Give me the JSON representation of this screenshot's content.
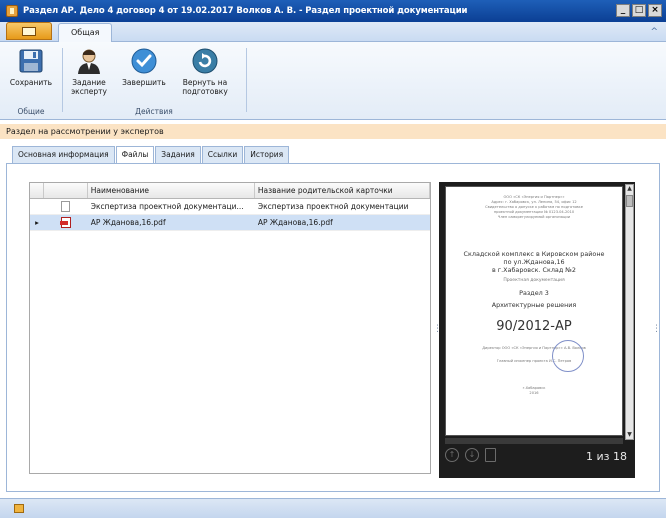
{
  "window": {
    "title": "Раздел АР.  Дело 4 договор 4 от 19.02.2017 Волков А. В. - Раздел проектной документации",
    "controls": [
      "_",
      "□",
      "×"
    ]
  },
  "ribbon": {
    "tab_general": "Общая",
    "collapse_icon": "^",
    "groups": {
      "general": {
        "label": "Общие",
        "save": "Сохранить"
      },
      "actions": {
        "label": "Действия",
        "task_line1": "Задание",
        "task_line2": "эксперту",
        "finish": "Завершить",
        "return_line1": "Вернуть на",
        "return_line2": "подготовку"
      }
    }
  },
  "status_text": "Раздел на рассмотрении у экспертов",
  "tabs": [
    "Основная информация",
    "Файлы",
    "Задания",
    "Ссылки",
    "История"
  ],
  "active_tab": "Файлы",
  "files_table": {
    "columns": [
      "Наименование",
      "Название родительской карточки"
    ],
    "rows": [
      {
        "indicator": "",
        "name": "Экспертиза проектной документаци...",
        "parent": "Экспертиза проектной документации",
        "icon": "document-icon"
      },
      {
        "indicator": "▸",
        "name": "АР Жданова,16.pdf",
        "parent": "АР Жданова,16.pdf",
        "icon": "pdf-icon"
      }
    ]
  },
  "viewer": {
    "pager": "1 из 18",
    "page": {
      "header_lines": [
        "ООО «СК «Энергия и Партнер»»",
        "Адрес: г. Хабаровск, ул. Ленина, 54, офис 12",
        "Свидетельство о допуске к работам по подготовке",
        "проектной документации № 0123.04-2010",
        "Член саморегулируемой организации"
      ],
      "project_lines": [
        "Складской комплекс в Кировском районе",
        "по ул.Жданова,16",
        "в г.Хабаровск. Склад №2"
      ],
      "doc_type": "Проектная документация",
      "section": "Раздел 3",
      "section_title": "Архитектурные решения",
      "code": "90/2012-АР",
      "sign_lines": [
        "Директор ООО «СК «Энергия и Партнер»»        А.В. Волков",
        "Главный инженер проекта                      И.С. Петров"
      ],
      "footer_lines": [
        "г.Хабаровск",
        "2016"
      ]
    }
  },
  "colors": {
    "titlebar": "#0b3f94",
    "status_strip": "#fbe3c4",
    "selected_row": "#cfe0f5",
    "viewer_bg": "#1d1d1d"
  }
}
